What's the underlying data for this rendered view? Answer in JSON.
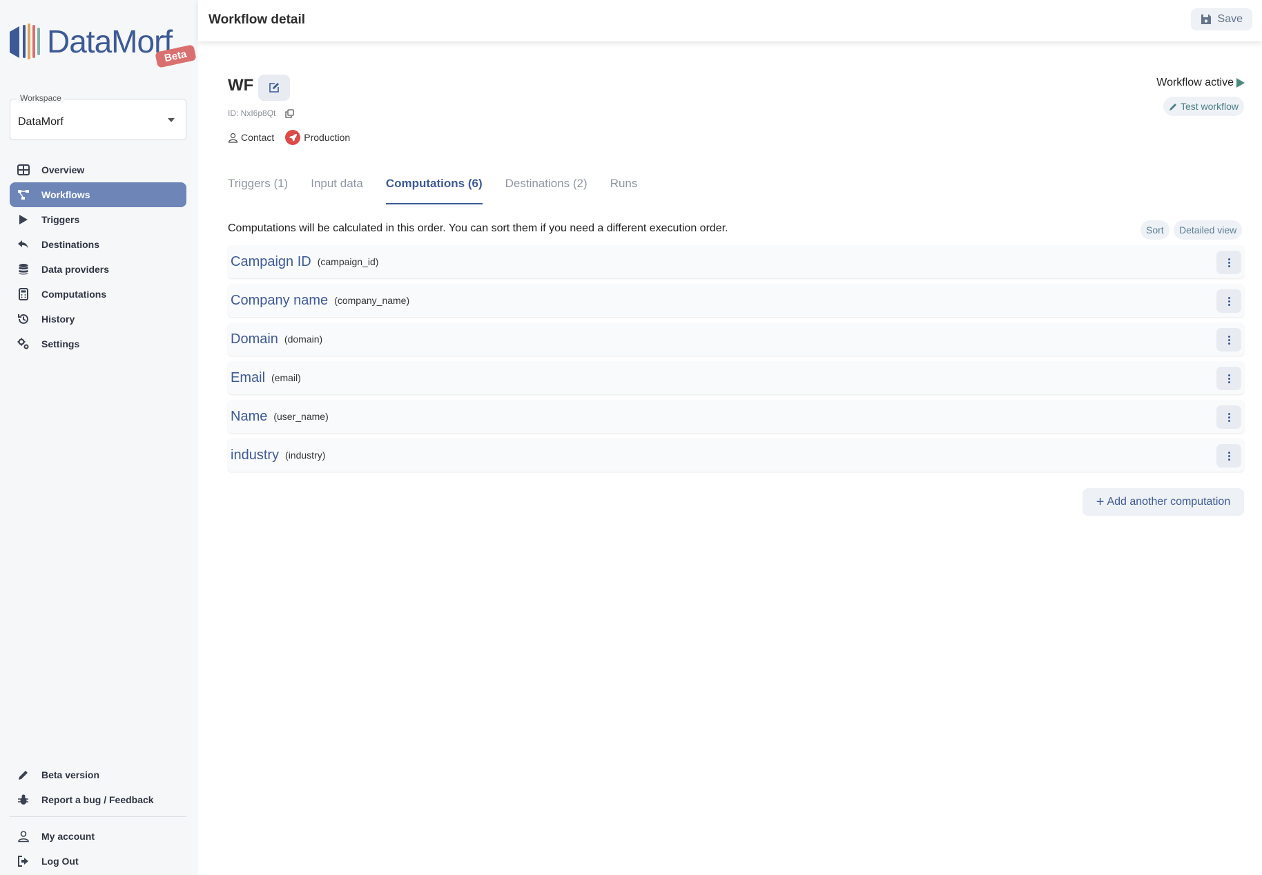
{
  "brand": {
    "name": "DataMorf",
    "badge": "Beta",
    "colors": {
      "primary": "#3d5a96",
      "active_nav": "#6d85b7",
      "production_red": "#dc4b48",
      "play_green": "#4a8a7c"
    }
  },
  "workspace": {
    "label": "Workspace",
    "value": "DataMorf"
  },
  "sidebar": {
    "items": [
      {
        "label": "Overview",
        "icon": "grid-icon"
      },
      {
        "label": "Workflows",
        "icon": "workflow-icon",
        "active": true
      },
      {
        "label": "Triggers",
        "icon": "play-icon"
      },
      {
        "label": "Destinations",
        "icon": "reply-icon"
      },
      {
        "label": "Data providers",
        "icon": "database-icon"
      },
      {
        "label": "Computations",
        "icon": "calculator-icon"
      },
      {
        "label": "History",
        "icon": "history-icon"
      },
      {
        "label": "Settings",
        "icon": "gears-icon"
      }
    ],
    "bottom": [
      {
        "label": "Beta version",
        "icon": "pencil-icon"
      },
      {
        "label": "Report a bug / Feedback",
        "icon": "bug-icon"
      },
      {
        "label": "My account",
        "icon": "user-icon"
      },
      {
        "label": "Log Out",
        "icon": "logout-icon"
      }
    ]
  },
  "header": {
    "title": "Workflow detail",
    "save_label": "Save"
  },
  "workflow": {
    "name": "WF",
    "id_text": "ID: NxI6p8Qt",
    "entity": "Contact",
    "environment": "Production",
    "status": "Workflow active",
    "test_label": "Test workflow"
  },
  "tabs": [
    {
      "label": "Triggers (1)"
    },
    {
      "label": "Input data"
    },
    {
      "label": "Computations (6)",
      "active": true
    },
    {
      "label": "Destinations (2)"
    },
    {
      "label": "Runs"
    }
  ],
  "computations": {
    "hint": "Computations will be calculated in this order. You can sort them if you need a different execution order.",
    "sort_label": "Sort",
    "detail_label": "Detailed view",
    "add_label": "Add another computation",
    "items": [
      {
        "name": "Campaign ID",
        "key": "(campaign_id)"
      },
      {
        "name": "Company name",
        "key": "(company_name)"
      },
      {
        "name": "Domain",
        "key": "(domain)"
      },
      {
        "name": "Email",
        "key": "(email)"
      },
      {
        "name": "Name",
        "key": "(user_name)"
      },
      {
        "name": "industry",
        "key": "(industry)"
      }
    ]
  }
}
